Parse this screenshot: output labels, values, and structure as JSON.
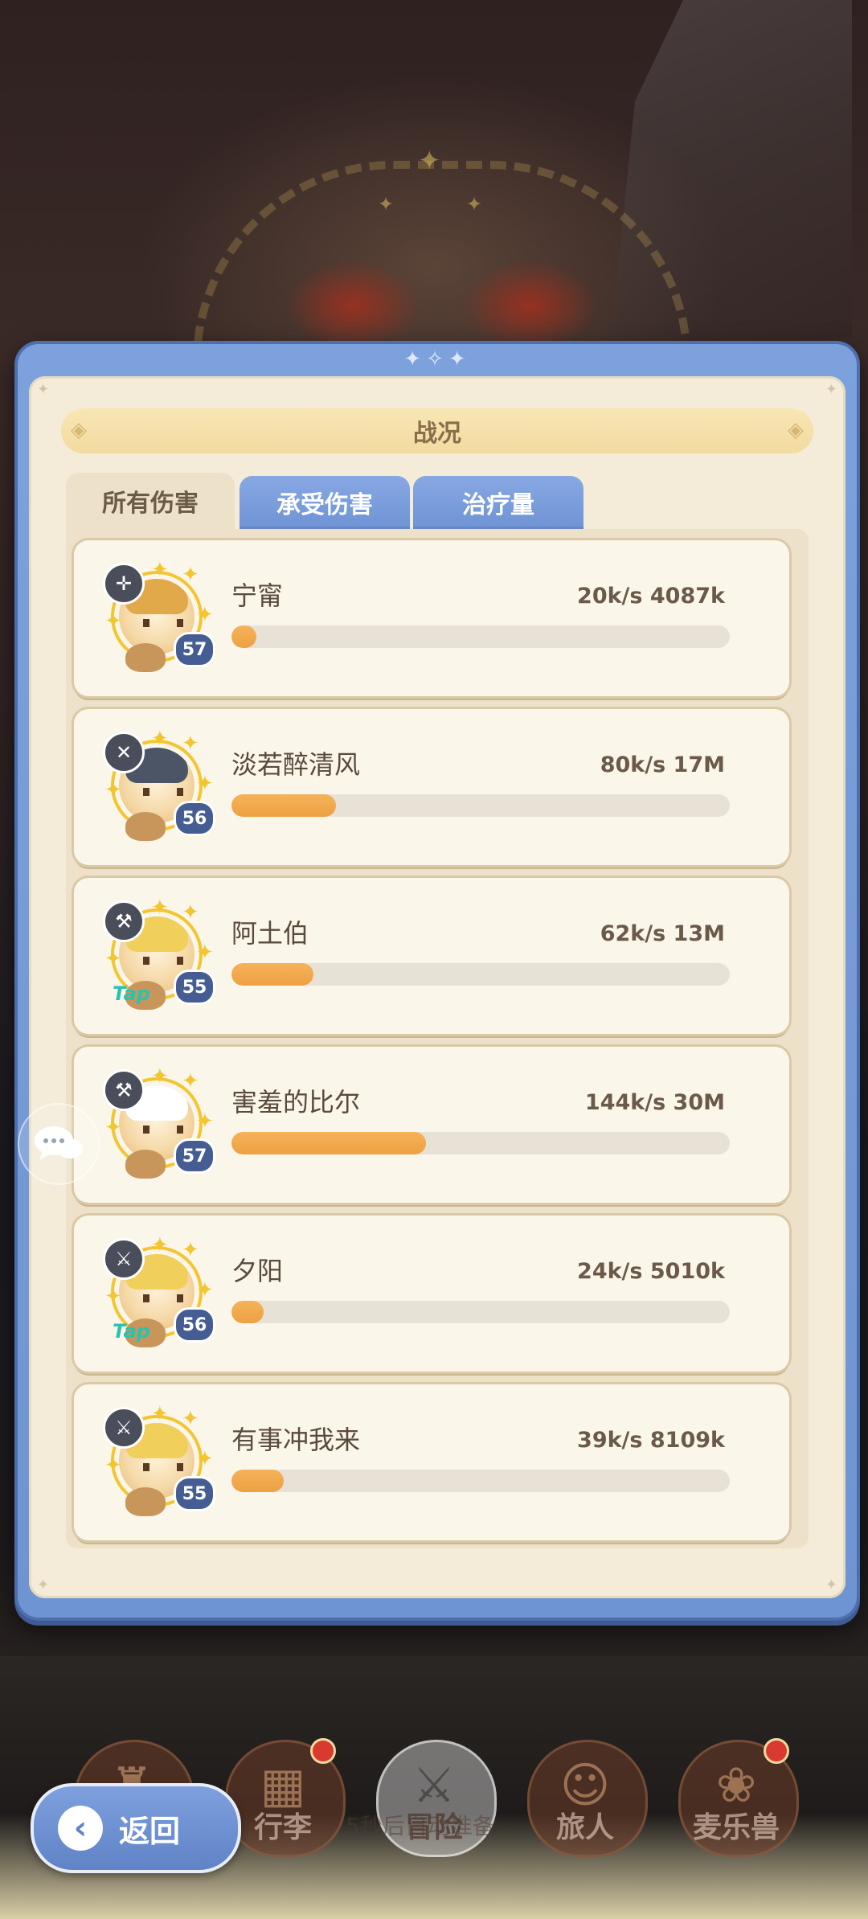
{
  "panel": {
    "title": "战况"
  },
  "tabs": [
    {
      "label": "所有伤害",
      "active": true
    },
    {
      "label": "承受伤害",
      "active": false
    },
    {
      "label": "治疗量",
      "active": false
    }
  ],
  "entries": [
    {
      "name": "宁甯",
      "stat": "20k/s 4087k",
      "level": "57",
      "role_icon": "crosshair-icon",
      "progress": 0.05,
      "hair": "#e2a94a"
    },
    {
      "name": "淡若醉清风",
      "stat": "80k/s 17M",
      "level": "56",
      "role_icon": "swords-icon",
      "progress": 0.21,
      "hair": "#4b5566"
    },
    {
      "name": "阿土伯",
      "stat": "62k/s 13M",
      "level": "55",
      "role_icon": "hammer-icon",
      "progress": 0.165,
      "hair": "#f0cf5a",
      "badge": "Tap"
    },
    {
      "name": "害羞的比尔",
      "stat": "144k/s 30M",
      "level": "57",
      "role_icon": "hammer-icon",
      "progress": 0.39,
      "hair": "#ffffff"
    },
    {
      "name": "夕阳",
      "stat": "24k/s 5010k",
      "level": "56",
      "role_icon": "dagger-icon",
      "progress": 0.065,
      "hair": "#f0cf5a",
      "badge": "Tap"
    },
    {
      "name": "有事冲我来",
      "stat": "39k/s 8109k",
      "level": "55",
      "role_icon": "dagger-icon",
      "progress": 0.105,
      "hair": "#f0cf5a"
    }
  ],
  "bottom_nav": [
    {
      "label": "",
      "icon": "castle-icon",
      "dot": false
    },
    {
      "label": "行李",
      "icon": "chest-icon",
      "dot": true
    },
    {
      "label": "冒险",
      "icon": "crossed-swords-icon",
      "dot": false,
      "active": true
    },
    {
      "label": "旅人",
      "icon": "traveler-icon",
      "dot": false
    },
    {
      "label": "麦乐兽",
      "icon": "pet-icon",
      "dot": true
    }
  ],
  "nav_hint": "5秒后自动准备",
  "back_button": {
    "label": "返回"
  },
  "colors": {
    "panel_blue": "#7da1dc",
    "bar_fill": "#f0a848",
    "card_bg": "#fbf6ea",
    "level_badge": "#455d92"
  }
}
